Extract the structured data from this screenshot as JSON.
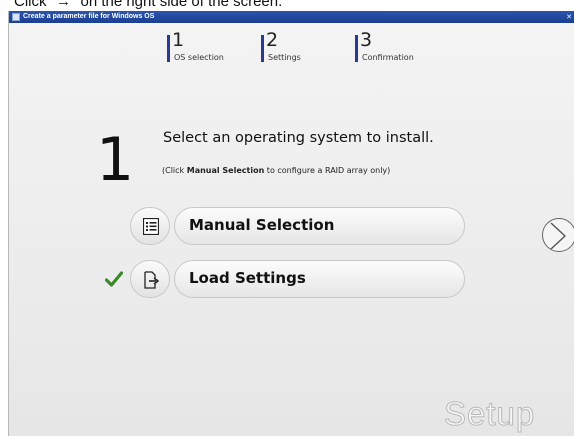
{
  "caption": {
    "text": "Click \"→\" on the right side of the screen."
  },
  "window": {
    "title": "Create a parameter file for Windows OS"
  },
  "steps": [
    {
      "number": "1",
      "label": "OS selection"
    },
    {
      "number": "2",
      "label": "Settings"
    },
    {
      "number": "3",
      "label": "Confirmation"
    }
  ],
  "main": {
    "step_number": "1",
    "heading": "Select an operating system to install.",
    "note_prefix": "(Click ",
    "note_bold": "Manual Selection",
    "note_suffix": " to configure a RAID array only)"
  },
  "options": [
    {
      "label": "Manual Selection",
      "icon": "list-icon",
      "checked": false
    },
    {
      "label": "Load Settings",
      "icon": "load-file-icon",
      "checked": true
    }
  ],
  "watermark": "Setup",
  "colors": {
    "titlebar": "#1f47a0",
    "checkmark": "#3a8a2a",
    "step_bar": "#2b3a8c"
  }
}
